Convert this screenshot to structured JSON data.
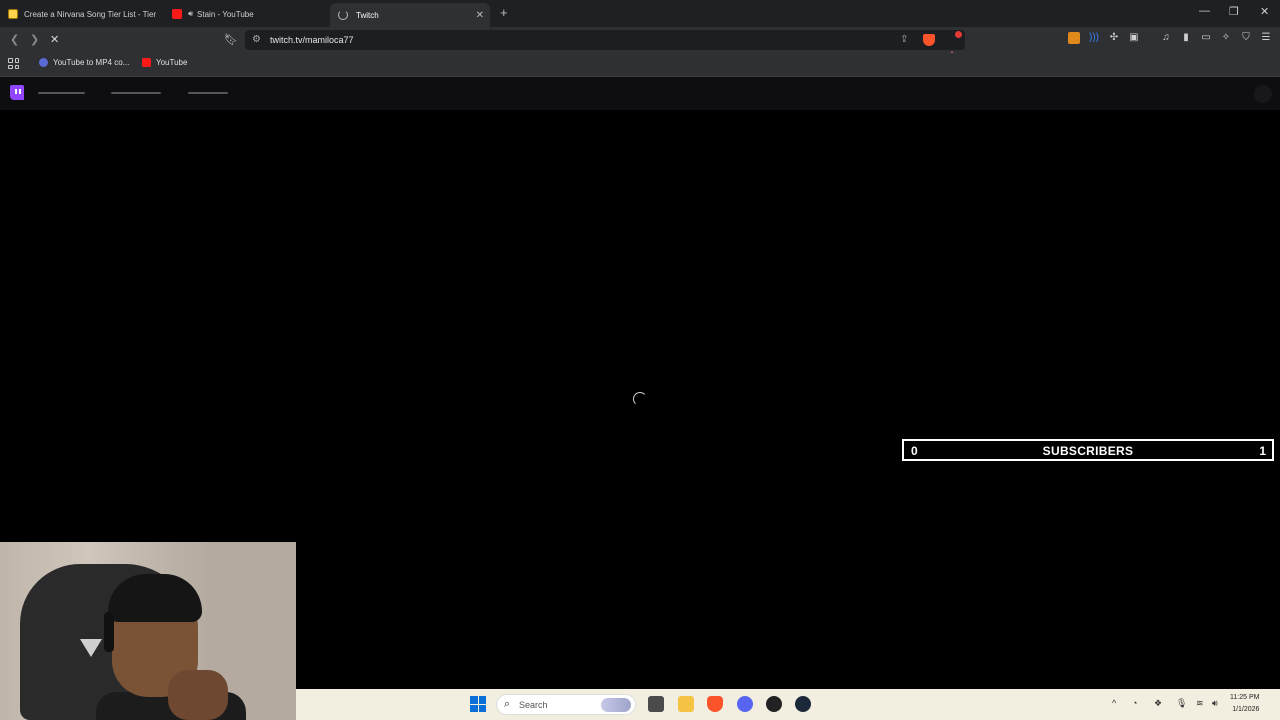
{
  "browser": {
    "tabs": [
      {
        "title": "Create a Nirvana Song Tier List - Tier",
        "favicon": "tierlist-icon",
        "active": false
      },
      {
        "title": "Stain - YouTube",
        "favicon": "youtube-icon",
        "audio": true,
        "active": false
      },
      {
        "title": "Twitch",
        "favicon": "loading-spinner-icon",
        "active": true
      }
    ],
    "url": "twitch.tv/mamiloca77",
    "bookmarks": [
      {
        "label": "YouTube to MP4 co...",
        "icon": "globe-icon"
      },
      {
        "label": "YouTube",
        "icon": "youtube-icon"
      }
    ]
  },
  "page": {
    "site": "Twitch",
    "state": "loading"
  },
  "overlay": {
    "subscribers_left": "0",
    "subscribers_label": "SUBSCRIBERS",
    "subscribers_right": "1"
  },
  "taskbar": {
    "search_placeholder": "Search",
    "time": "11:25 PM",
    "date": "1/1/2026"
  },
  "colors": {
    "twitch_purple": "#9146ff",
    "browser_bg": "#2f3034",
    "taskbar_bg": "#f2eee0",
    "brave_orange": "#fb542b"
  }
}
